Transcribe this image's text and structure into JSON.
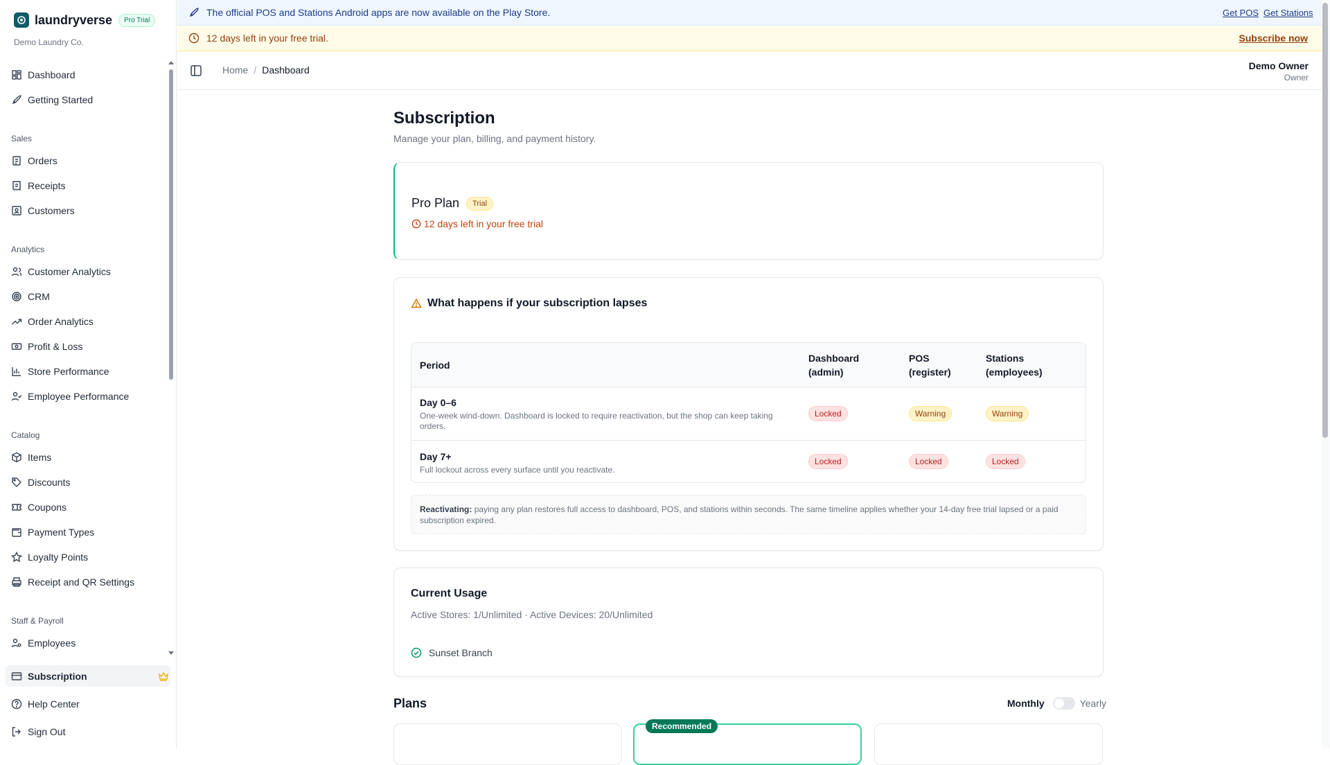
{
  "brand": {
    "name": "laundryverse",
    "badge": "Pro Trial",
    "org": "Demo Laundry Co."
  },
  "sidebar": {
    "top": [
      {
        "label": "Dashboard",
        "icon": "dashboard-icon"
      },
      {
        "label": "Getting Started",
        "icon": "rocket-icon"
      }
    ],
    "sections": [
      {
        "title": "Sales",
        "items": [
          {
            "label": "Orders",
            "icon": "clipboard-icon"
          },
          {
            "label": "Receipts",
            "icon": "receipt-icon"
          },
          {
            "label": "Customers",
            "icon": "contact-icon"
          }
        ]
      },
      {
        "title": "Analytics",
        "items": [
          {
            "label": "Customer Analytics",
            "icon": "users-icon"
          },
          {
            "label": "CRM",
            "icon": "target-icon"
          },
          {
            "label": "Order Analytics",
            "icon": "trend-up-icon"
          },
          {
            "label": "Profit & Loss",
            "icon": "banknote-icon"
          },
          {
            "label": "Store Performance",
            "icon": "bar-chart-icon"
          },
          {
            "label": "Employee Performance",
            "icon": "user-check-icon"
          }
        ]
      },
      {
        "title": "Catalog",
        "items": [
          {
            "label": "Items",
            "icon": "package-icon"
          },
          {
            "label": "Discounts",
            "icon": "tag-icon"
          },
          {
            "label": "Coupons",
            "icon": "ticket-icon"
          },
          {
            "label": "Payment Types",
            "icon": "wallet-icon"
          },
          {
            "label": "Loyalty Points",
            "icon": "star-icon"
          },
          {
            "label": "Receipt and QR Settings",
            "icon": "printer-icon"
          }
        ]
      },
      {
        "title": "Staff & Payroll",
        "items": [
          {
            "label": "Employees",
            "icon": "user-cog-icon"
          }
        ]
      }
    ],
    "bottom": [
      {
        "label": "Subscription",
        "icon": "card-icon",
        "active": true
      },
      {
        "label": "Help Center",
        "icon": "help-icon"
      },
      {
        "label": "Sign Out",
        "icon": "logout-icon"
      }
    ]
  },
  "banners": {
    "apps": {
      "text": "The official POS and Stations Android apps are now available on the Play Store.",
      "link1": "Get POS",
      "link2": "Get Stations"
    },
    "trial": {
      "text": "12 days left in your free trial.",
      "link": "Subscribe now"
    }
  },
  "topbar": {
    "crumb_home": "Home",
    "crumb_sep": "/",
    "crumb_current": "Dashboard",
    "user_name": "Demo Owner",
    "user_role": "Owner"
  },
  "page": {
    "title": "Subscription",
    "subtitle": "Manage your plan, billing, and payment history."
  },
  "plan": {
    "name": "Pro Plan",
    "badge": "Trial",
    "days_left": "12 days left in your free trial"
  },
  "lapse": {
    "title": "What happens if your subscription lapses",
    "headers": {
      "period": "Period",
      "dashboard_1": "Dashboard",
      "dashboard_2": "(admin)",
      "pos_1": "POS",
      "pos_2": "(register)",
      "stations_1": "Stations",
      "stations_2": "(employees)"
    },
    "rows": [
      {
        "period": "Day 0–6",
        "desc": "One-week wind-down. Dashboard is locked to require reactivation, but the shop can keep taking orders.",
        "dashboard": "Locked",
        "pos": "Warning",
        "stations": "Warning"
      },
      {
        "period": "Day 7+",
        "desc": "Full lockout across every surface until you reactivate.",
        "dashboard": "Locked",
        "pos": "Locked",
        "stations": "Locked"
      }
    ],
    "note_label": "Reactivating:",
    "note_text": " paying any plan restores full access to dashboard, POS, and stations within seconds. The same timeline applies whether your 14-day free trial lapsed or a paid subscription expired."
  },
  "usage": {
    "title": "Current Usage",
    "line": "Active Stores: 1/Unlimited · Active Devices: 20/Unlimited",
    "store": "Sunset Branch"
  },
  "plans": {
    "title": "Plans",
    "monthly": "Monthly",
    "yearly": "Yearly",
    "recommended": "Recommended",
    "yearly_enabled": false
  },
  "colors": {
    "accent": "#10b981",
    "brand": "#0f5b66",
    "warning": "#92400e",
    "danger": "#b91c1c"
  }
}
